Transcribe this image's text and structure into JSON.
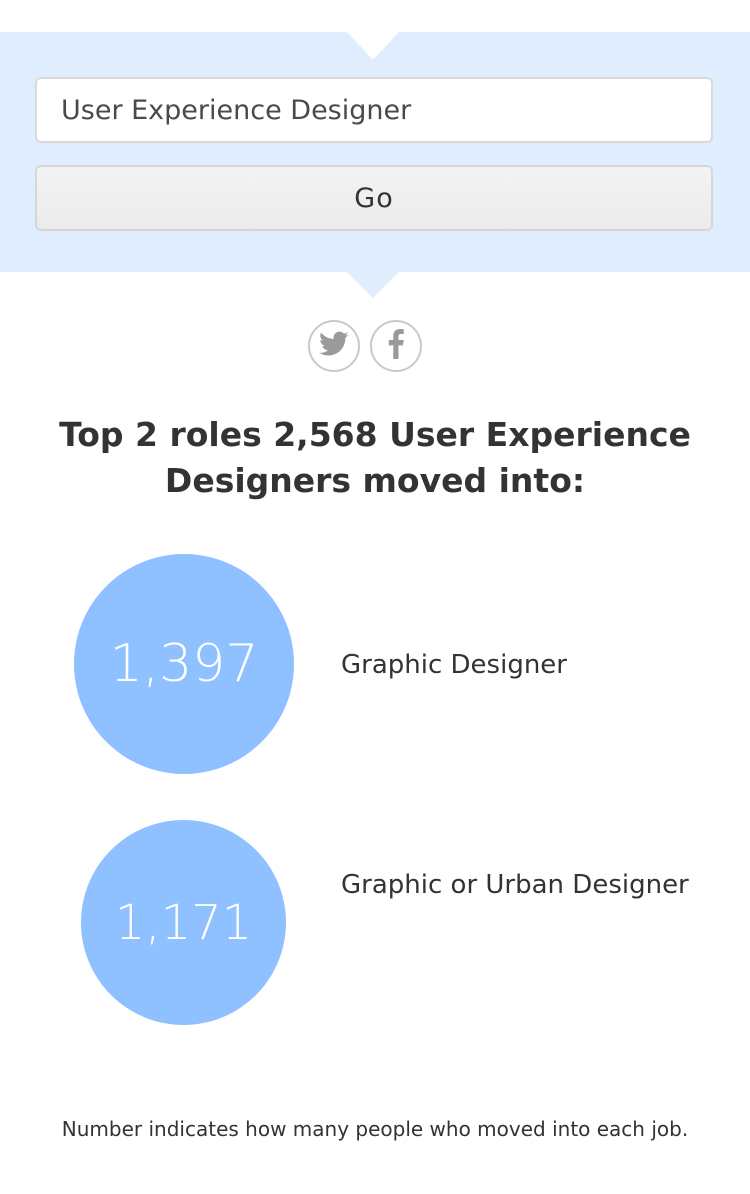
{
  "search": {
    "value": "User Experience Designer",
    "go_label": "Go"
  },
  "social": [
    {
      "icon": "twitter-icon"
    },
    {
      "icon": "facebook-icon"
    }
  ],
  "heading": "Top 2 roles 2,568 User Experience Designers moved into:",
  "results": [
    {
      "count": "1,397",
      "role": "Graphic Designer"
    },
    {
      "count": "1,171",
      "role": "Graphic or Urban Designer"
    }
  ],
  "footnote": "Number indicates how many people who moved into each job.",
  "colors": {
    "panel_background": "#e0edff",
    "circle_fill": "#8fc0ff"
  }
}
